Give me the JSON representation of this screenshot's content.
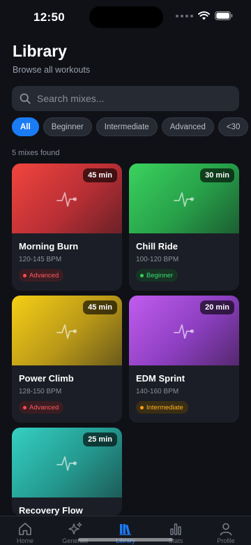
{
  "status_bar": {
    "time": "12:50"
  },
  "header": {
    "title": "Library",
    "subtitle": "Browse all workouts"
  },
  "search": {
    "placeholder": "Search mixes...",
    "value": ""
  },
  "filters": [
    "All",
    "Beginner",
    "Intermediate",
    "Advanced",
    "<30"
  ],
  "active_filter": "All",
  "result_count": "5 mixes found",
  "mixes": [
    {
      "title": "Morning Burn",
      "bpm": "120-145 BPM",
      "duration": "45 min",
      "level": "Advanced",
      "color": "#f2453e"
    },
    {
      "title": "Chill Ride",
      "bpm": "100-120 BPM",
      "duration": "30 min",
      "level": "Beginner",
      "color": "#3bd25e"
    },
    {
      "title": "Power Climb",
      "bpm": "128-150 BPM",
      "duration": "45 min",
      "level": "Advanced",
      "color": "#f5cf16"
    },
    {
      "title": "EDM Sprint",
      "bpm": "140-160 BPM",
      "duration": "20 min",
      "level": "Intermediate",
      "color": "#c25cf0"
    },
    {
      "title": "Recovery Flow",
      "bpm": "",
      "duration": "25 min",
      "level": "",
      "color": "#35d0c2"
    }
  ],
  "tabs": [
    {
      "label": "Home",
      "icon": "home-icon"
    },
    {
      "label": "Generate",
      "icon": "sparkles-icon"
    },
    {
      "label": "Library",
      "icon": "library-icon"
    },
    {
      "label": "Stats",
      "icon": "stats-icon"
    },
    {
      "label": "Profile",
      "icon": "profile-icon"
    }
  ],
  "active_tab": "Library",
  "colors": {
    "accent": "#1a7cf5",
    "background": "#0f1117",
    "card": "#1b1e26"
  }
}
